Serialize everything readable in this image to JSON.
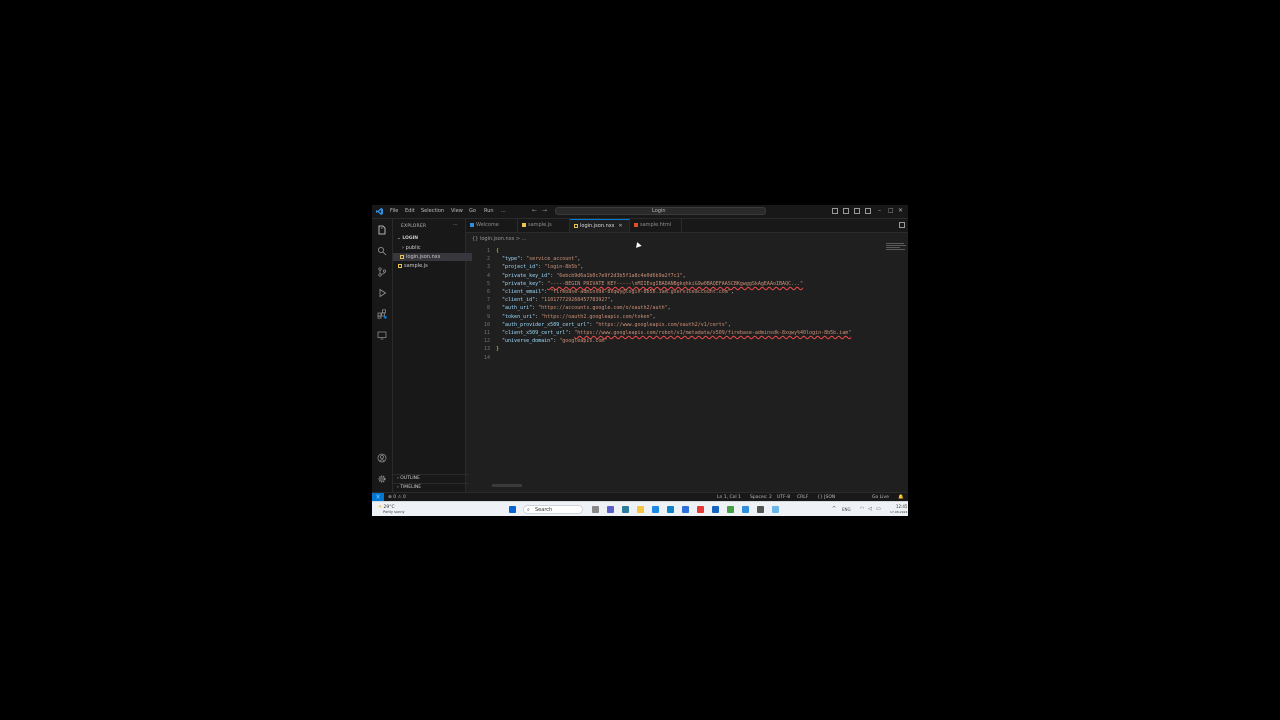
{
  "titlebar": {
    "menus": [
      "File",
      "Edit",
      "Selection",
      "View",
      "Go",
      "Run",
      "..."
    ],
    "command_center": "Login",
    "nav_back": "←",
    "nav_forward": "→",
    "win_min": "–",
    "win_max": "□",
    "win_close": "✕"
  },
  "sidebar": {
    "header": "EXPLORER",
    "dots": "···",
    "root": "LOGIN",
    "items": [
      {
        "label": "public",
        "type": "folder"
      },
      {
        "label": "login.json.nxs",
        "type": "json",
        "selected": true
      },
      {
        "label": "sample.js",
        "type": "js"
      }
    ],
    "outline": "OUTLINE",
    "timeline": "TIMELINE"
  },
  "tabs": [
    {
      "label": "Welcome",
      "active": false
    },
    {
      "label": "sample.js",
      "active": false
    },
    {
      "label": "login.json.nxs",
      "active": true,
      "close": "✕"
    },
    {
      "label": "sample.html",
      "active": false
    }
  ],
  "breadcrumb": "{} login.json.nxs > ...",
  "editor": {
    "lines": [
      {
        "n": "1",
        "parts": [
          {
            "t": "{",
            "c": "br"
          }
        ]
      },
      {
        "n": "2",
        "parts": [
          {
            "t": "  \"type\"",
            "c": "k"
          },
          {
            "t": ": ",
            "c": "p"
          },
          {
            "t": "\"service_account\"",
            "c": "s"
          },
          {
            "t": ",",
            "c": "p"
          }
        ]
      },
      {
        "n": "3",
        "parts": [
          {
            "t": "  \"project_id\"",
            "c": "k"
          },
          {
            "t": ": ",
            "c": "p"
          },
          {
            "t": "\"login-8b5b\"",
            "c": "s"
          },
          {
            "t": ",",
            "c": "p"
          }
        ]
      },
      {
        "n": "4",
        "parts": [
          {
            "t": "  \"private_key_id\"",
            "c": "k"
          },
          {
            "t": ": ",
            "c": "p"
          },
          {
            "t": "\"6ebcb9d6a1b0c7e9f2d3b5f1a8c4e0d6b9a2f7c1\"",
            "c": "s"
          },
          {
            "t": ",",
            "c": "p"
          }
        ]
      },
      {
        "n": "5",
        "parts": [
          {
            "t": "  \"private_key\"",
            "c": "k"
          },
          {
            "t": ": ",
            "c": "p"
          },
          {
            "t": "\"-----BEGIN PRIVATE KEY-----\\nMIIEvgIBADANBgkqhkiG9w0BAQEFAASCBKgwggSkAgEAAoIBAQC...\"",
            "c": "s err"
          }
        ]
      },
      {
        "n": "6",
        "parts": [
          {
            "t": "  \"client_email\"",
            "c": "k"
          },
          {
            "t": ": ",
            "c": "p"
          },
          {
            "t": "\"firebase-adminsdk-8xqwy@login-8b5b.iam.gserviceaccount.com\"",
            "c": "s"
          },
          {
            "t": ",",
            "c": "p"
          }
        ]
      },
      {
        "n": "7",
        "parts": [
          {
            "t": "  \"client_id\"",
            "c": "k"
          },
          {
            "t": ": ",
            "c": "p"
          },
          {
            "t": "\"110177729268457783927\"",
            "c": "s"
          },
          {
            "t": ",",
            "c": "p"
          }
        ]
      },
      {
        "n": "8",
        "parts": [
          {
            "t": "  \"auth_uri\"",
            "c": "k"
          },
          {
            "t": ": ",
            "c": "p"
          },
          {
            "t": "\"https://accounts.google.com/o/oauth2/auth\"",
            "c": "s"
          },
          {
            "t": ",",
            "c": "p"
          }
        ]
      },
      {
        "n": "9",
        "parts": [
          {
            "t": "  \"token_uri\"",
            "c": "k"
          },
          {
            "t": ": ",
            "c": "p"
          },
          {
            "t": "\"https://oauth2.googleapis.com/token\"",
            "c": "s"
          },
          {
            "t": ",",
            "c": "p"
          }
        ]
      },
      {
        "n": "10",
        "parts": [
          {
            "t": "  \"auth_provider_x509_cert_url\"",
            "c": "k"
          },
          {
            "t": ": ",
            "c": "p"
          },
          {
            "t": "\"https://www.googleapis.com/oauth2/v1/certs\"",
            "c": "s"
          },
          {
            "t": ",",
            "c": "p"
          }
        ]
      },
      {
        "n": "11",
        "parts": [
          {
            "t": "  \"client_x509_cert_url\"",
            "c": "k"
          },
          {
            "t": ": ",
            "c": "p"
          },
          {
            "t": "\"https://www.googleapis.com/robot/v1/metadata/x509/firebase-adminsdk-8xqwy%40login-8b5b.iam\"",
            "c": "s err"
          }
        ]
      },
      {
        "n": "12",
        "parts": [
          {
            "t": "  \"universe_domain\"",
            "c": "k"
          },
          {
            "t": ": ",
            "c": "p"
          },
          {
            "t": "\"googleapis.com\"",
            "c": "s"
          }
        ]
      },
      {
        "n": "13",
        "parts": [
          {
            "t": "}",
            "c": "br"
          }
        ]
      },
      {
        "n": "14",
        "parts": []
      }
    ]
  },
  "status": {
    "remote": "⟩⟨",
    "problems": "⊗ 0 ⚠ 0",
    "position": "Ln 1, Col 1",
    "spaces": "Spaces: 2",
    "encoding": "UTF-8",
    "eol": "CRLF",
    "language": "{} JSON",
    "golive": "Go Live",
    "bell": "🔔"
  },
  "taskbar": {
    "weather_temp": "29°C",
    "weather_desc": "Partly sunny",
    "search_label": "Search",
    "time": "12:45",
    "date": "17-08-2024",
    "lang": "ENG"
  },
  "colors": {
    "accent": "#0078d4",
    "editor_bg": "#1f1f1f",
    "key": "#9cdcfe",
    "string": "#ce9178"
  }
}
